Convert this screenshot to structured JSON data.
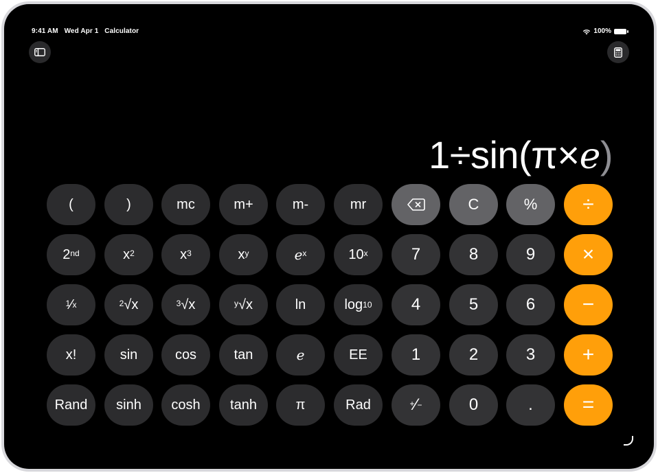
{
  "status_bar": {
    "time": "9:41 AM",
    "date": "Wed Apr 1",
    "app": "Calculator",
    "battery": "100%"
  },
  "toolbar": {
    "sidebar_icon": "sidebar-icon",
    "calculator_icon": "calculator-icon"
  },
  "display": {
    "expression_prefix": "1÷sin(π×",
    "expression_e": "e",
    "expression_suffix": ")"
  },
  "keys": {
    "row1": [
      "(",
      ")",
      "mc",
      "m+",
      "m-",
      "mr",
      "⌫",
      "C",
      "%",
      "÷"
    ],
    "row2": [
      "2nd",
      "x2",
      "x3",
      "xy",
      "ex",
      "10x",
      "7",
      "8",
      "9",
      "×"
    ],
    "row3": [
      "1/x",
      "2√x",
      "3√x",
      "y√x",
      "ln",
      "log10",
      "4",
      "5",
      "6",
      "−"
    ],
    "row4": [
      "x!",
      "sin",
      "cos",
      "tan",
      "e",
      "EE",
      "1",
      "2",
      "3",
      "+"
    ],
    "row5": [
      "Rand",
      "sinh",
      "cosh",
      "tanh",
      "π",
      "Rad",
      "+/−",
      "0",
      ".",
      "="
    ]
  },
  "labels": {
    "open_paren": "(",
    "close_paren": ")",
    "mc": "mc",
    "mplus": "m+",
    "mminus": "m-",
    "mr": "mr",
    "clear": "C",
    "percent": "%",
    "divide": "÷",
    "seven": "7",
    "eight": "8",
    "nine": "9",
    "multiply": "×",
    "ln": "ln",
    "four": "4",
    "five": "5",
    "six": "6",
    "minus": "−",
    "fact": "x!",
    "sin": "sin",
    "cos": "cos",
    "tan": "tan",
    "e": "e",
    "ee": "EE",
    "one": "1",
    "two": "2",
    "three": "3",
    "plus": "+",
    "rand": "Rand",
    "sinh": "sinh",
    "cosh": "cosh",
    "tanh": "tanh",
    "pi": "π",
    "rad": "Rad",
    "zero": "0",
    "dot": ".",
    "equals": "="
  },
  "colors": {
    "background": "#000000",
    "function_key": "#2c2c2e",
    "number_key": "#333335",
    "gray_key": "#636366",
    "operator_key": "#ff9f0a"
  }
}
